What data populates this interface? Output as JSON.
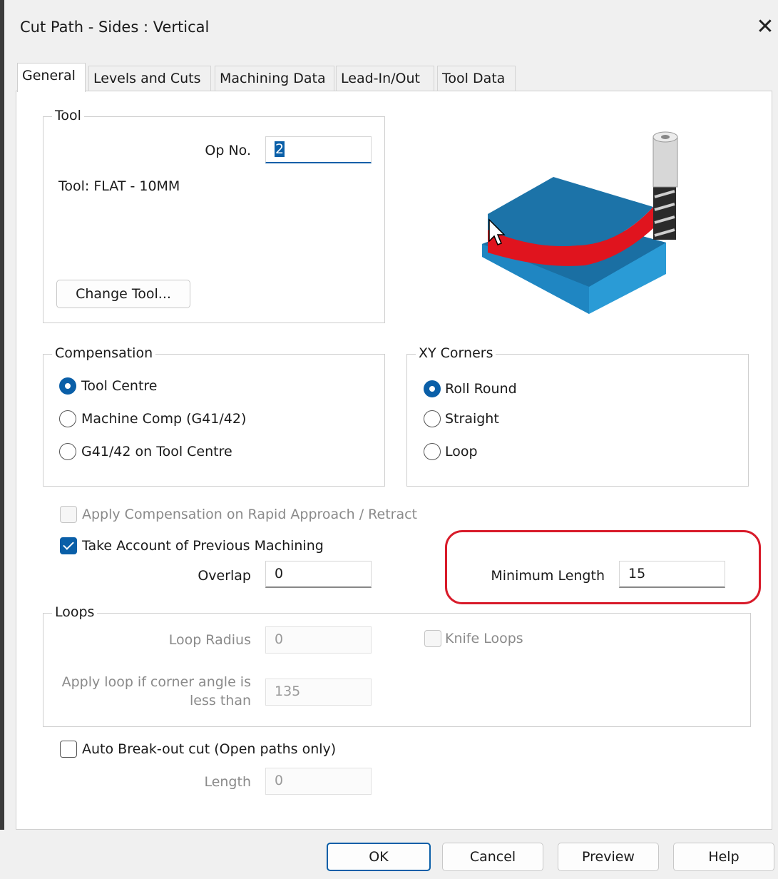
{
  "window": {
    "title": "Cut Path - Sides : Vertical",
    "close_glyph": "✕"
  },
  "tabs": [
    {
      "label": "General"
    },
    {
      "label": "Levels and Cuts"
    },
    {
      "label": "Machining Data"
    },
    {
      "label": "Lead-In/Out"
    },
    {
      "label": "Tool Data"
    }
  ],
  "tool": {
    "group_label": "Tool",
    "op_no_label": "Op No.",
    "op_no_value": "2",
    "tool_text": "Tool: FLAT - 10MM",
    "change_tool_label": "Change Tool..."
  },
  "compensation": {
    "group_label": "Compensation",
    "options": [
      "Tool Centre",
      "Machine Comp (G41/42)",
      "G41/42 on Tool Centre"
    ],
    "selected": "Tool Centre"
  },
  "xy_corners": {
    "group_label": "XY Corners",
    "options": [
      "Roll Round",
      "Straight",
      "Loop"
    ],
    "selected": "Roll Round"
  },
  "apply_comp_rapid": {
    "label": "Apply Compensation on Rapid Approach / Retract",
    "checked": false,
    "enabled": false
  },
  "take_account_prev": {
    "label": "Take Account of Previous Machining",
    "checked": true
  },
  "overlap": {
    "label": "Overlap",
    "value": "0"
  },
  "minimum_length": {
    "label": "Minimum Length",
    "value": "15"
  },
  "loops": {
    "group_label": "Loops",
    "loop_radius_label": "Loop Radius",
    "loop_radius_value": "0",
    "knife_loops_label": "Knife Loops",
    "corner_angle_label_1": "Apply loop if corner angle is",
    "corner_angle_label_2": "less than",
    "corner_angle_value": "135"
  },
  "auto_breakout": {
    "label": "Auto Break-out cut (Open paths only)",
    "checked": false
  },
  "length": {
    "label": "Length",
    "value": "0"
  },
  "footer": {
    "ok_label": "OK",
    "cancel_label": "Cancel",
    "preview_label": "Preview",
    "help_label": "Help"
  },
  "colors": {
    "accent": "#0a5fa8",
    "highlight": "#d81b2a",
    "block_top": "#1c73a8",
    "block_side": "#2a9bd6",
    "cut_edge": "#e0141e"
  }
}
